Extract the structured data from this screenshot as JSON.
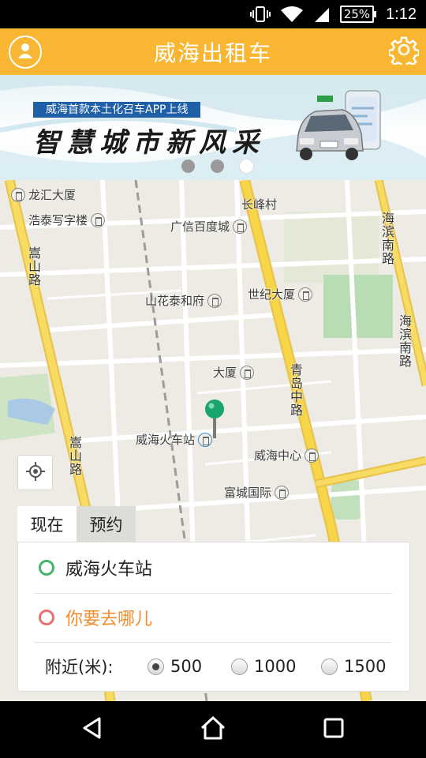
{
  "status_bar": {
    "battery": "25%",
    "time": "1:12"
  },
  "app_bar": {
    "title": "威海出租车"
  },
  "banner": {
    "subtitle": "威海首款本土化召车APP上线",
    "title": "智慧城市新风采",
    "page_count": 3,
    "active_page": 3
  },
  "map": {
    "labels": {
      "longhui": "龙汇大厦",
      "haotai": "浩泰写字楼",
      "changfeng": "长峰村",
      "guangxin": "广信百度城",
      "shanhua": "山花泰和府",
      "shiji": "世纪大厦",
      "dasha": "大厦",
      "station": "威海火车站",
      "center": "威海中心",
      "fucheng": "富城国际",
      "road_songshan": "嵩山路",
      "road_songshan2": "嵩山路",
      "road_qingdao": "青岛中路",
      "road_haibin": "海滨南路",
      "road_haibin2": "海滨南路"
    }
  },
  "tabs": {
    "now": "现在",
    "reserve": "预约",
    "active": "now"
  },
  "panel": {
    "origin": "威海火车站",
    "destination_placeholder": "你要去哪儿",
    "nearby_label": "附近(米):",
    "radius_options": [
      "500",
      "1000",
      "1500"
    ],
    "radius_selected": "500"
  },
  "colors": {
    "accent": "#f8b633",
    "origin_ring": "#46b46a",
    "destination_ring": "#e77070",
    "destination_text": "#f28c2c",
    "pin": "#1aa56e"
  }
}
